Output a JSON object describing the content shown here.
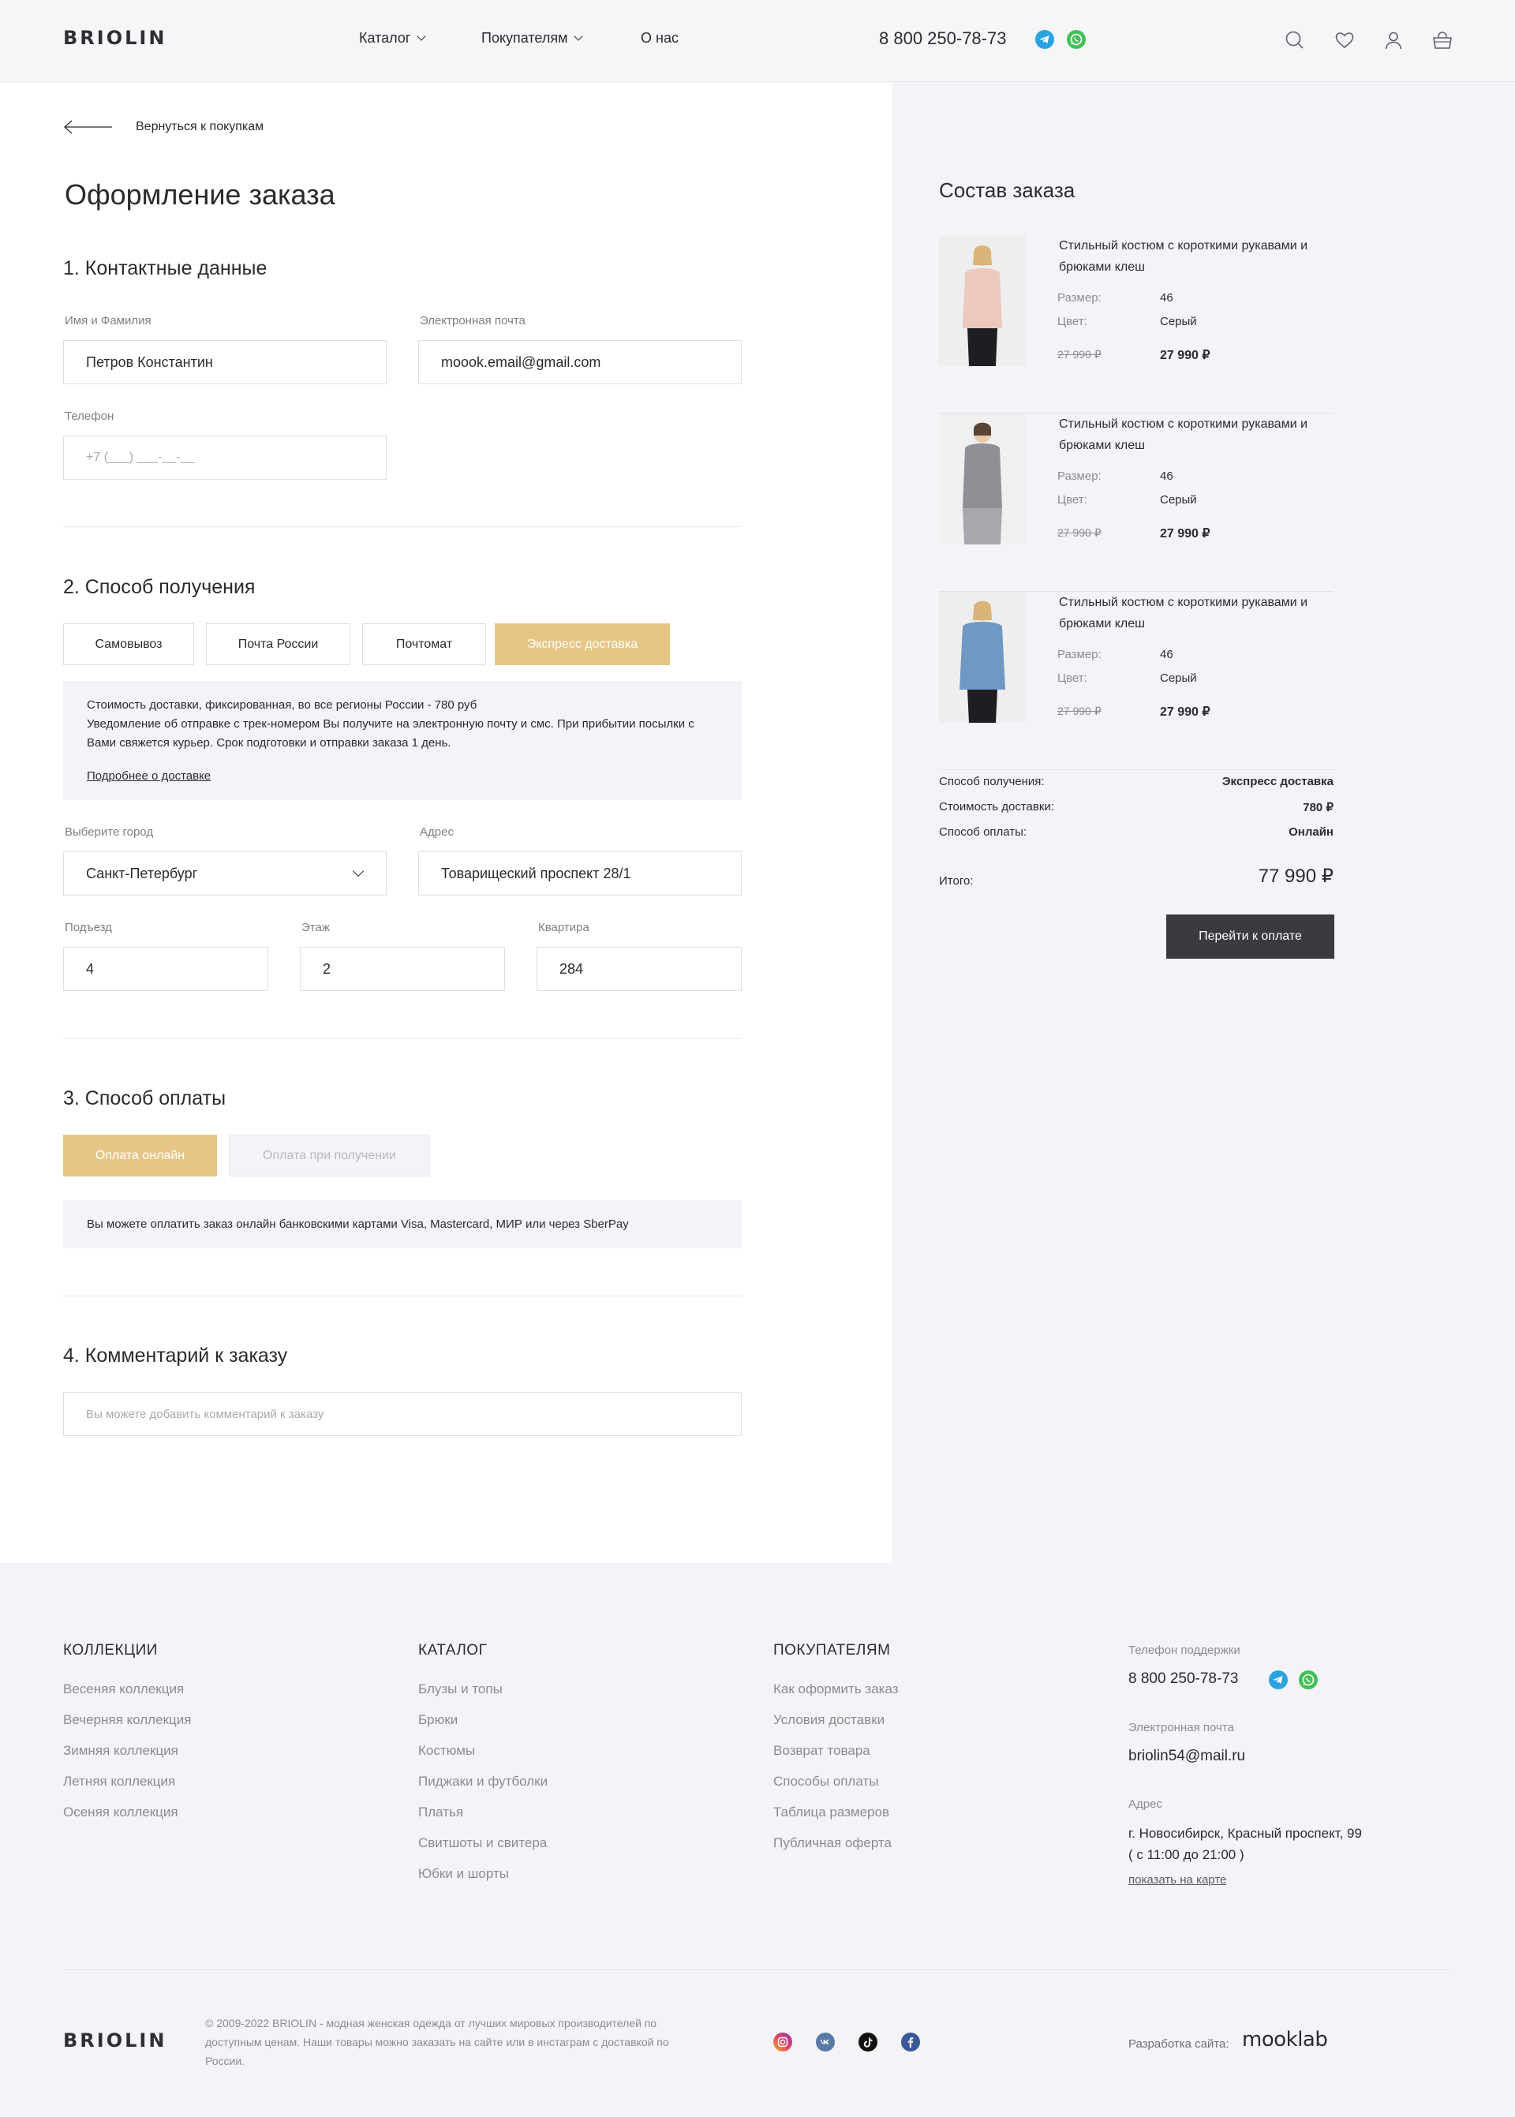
{
  "header": {
    "logo": "BRIOLIN",
    "nav": [
      {
        "label": "Каталог"
      },
      {
        "label": "Покупателям"
      },
      {
        "label": "О нас"
      }
    ],
    "phone": "8 800 250-78-73",
    "icons": [
      "search-icon",
      "heart-icon",
      "user-icon",
      "cart-icon"
    ]
  },
  "checkout": {
    "back_label": "Вернуться к покупкам",
    "title": "Оформление заказа",
    "contacts": {
      "title": "1. Контактные данные",
      "name_label": "Имя и Фамилия",
      "name_value": "Петров Константин",
      "email_label": "Электронная почта",
      "email_value": "moook.email@gmail.com",
      "phone_label": "Телефон",
      "phone_placeholder": "+7 (___) ___-__-__"
    },
    "delivery": {
      "title": "2. Способ получения",
      "options": [
        "Самовывоз",
        "Почта России",
        "Почтомат",
        "Экспресс доставка"
      ],
      "selected": "Экспресс доставка",
      "info_line1": "Стоимость доставки, фиксированная, во все регионы России - 780 руб",
      "info_line2": "Уведомление об отправке с трек-номером Вы получите на электронную почту и смс. При прибытии посылки с Вами свяжется курьер. Срок подготовки и отправки заказа 1 день.",
      "info_link": "Подробнее о доставке",
      "city_label": "Выберите город",
      "city_value": "Санкт-Петербург",
      "address_label": "Адрес",
      "address_value": "Товарищеский проспект 28/1",
      "entrance_label": "Подъезд",
      "entrance_value": "4",
      "floor_label": "Этаж",
      "floor_value": "2",
      "apartment_label": "Квартира",
      "apartment_value": "284"
    },
    "payment": {
      "title": "3. Способ оплаты",
      "options": [
        "Оплата онлайн",
        "Оплата при получении"
      ],
      "selected": "Оплата онлайн",
      "info": "Вы можете оплатить заказ онлайн банковскими картами Visa, Mastercard, МИР или через SberPay"
    },
    "comment": {
      "title": "4. Комментарий к заказу",
      "placeholder": "Вы можете добавить комментарий к заказу"
    }
  },
  "order": {
    "title": "Состав заказа",
    "items": [
      {
        "name": "Стильный костюм с короткими рукавами и брюками клеш",
        "size_label": "Размер:",
        "size": "46",
        "color_label": "Цвет:",
        "color": "Серый",
        "old_price": "27 990 ₽",
        "price": "27 990 ₽",
        "image_colors": {
          "top": "#ecc9bf",
          "bottom": "#1e1e22"
        }
      },
      {
        "name": "Стильный костюм с короткими рукавами и брюками клеш",
        "size_label": "Размер:",
        "size": "46",
        "color_label": "Цвет:",
        "color": "Серый",
        "old_price": "27 990 ₽",
        "price": "27 990 ₽",
        "image_colors": {
          "top": "#8e9096",
          "bottom": "#a6a8ae"
        }
      },
      {
        "name": "Стильный костюм с короткими рукавами и брюками клеш",
        "size_label": "Размер:",
        "size": "46",
        "color_label": "Цвет:",
        "color": "Серый",
        "old_price": "27 990 ₽",
        "price": "27 990 ₽",
        "image_colors": {
          "top": "#6f99c2",
          "bottom": "#1e1e22"
        }
      }
    ],
    "summary": [
      {
        "label": "Способ получения:",
        "value": "Экспресс доставка"
      },
      {
        "label": "Стоимость доставки:",
        "value": "780 ₽"
      },
      {
        "label": "Способ оплаты:",
        "value": "Онлайн"
      }
    ],
    "total_label": "Итого:",
    "total_value": "77 990 ₽",
    "pay_button": "Перейти к оплате"
  },
  "footer": {
    "collections": {
      "title": "КОЛЛЕКЦИИ",
      "links": [
        "Весеняя коллекция",
        "Вечерняя коллекция",
        "Зимняя коллекция",
        "Летняя коллекция",
        "Осеняя коллекция"
      ]
    },
    "catalog": {
      "title": "КАТАЛОГ",
      "links": [
        "Блузы и топы",
        "Брюки",
        "Костюмы",
        "Пиджаки и футболки",
        "Платья",
        "Свитшоты и свитера",
        "Юбки и шорты"
      ]
    },
    "buyers": {
      "title": "ПОКУПАТЕЛЯМ",
      "links": [
        "Как оформить заказ",
        "Условия доставки",
        "Возврат товара",
        "Способы оплаты",
        "Таблица размеров",
        "Публичная оферта"
      ]
    },
    "contacts": {
      "phone_label": "Телефон поддержки",
      "phone": "8 800 250-78-73",
      "email_label": "Электронная почта",
      "email": "briolin54@mail.ru",
      "address_label": "Адрес",
      "address": "г. Новосибирск, Красный проспект, 99 ( с 11:00 до 21:00 )",
      "map_link": "показать на карте"
    },
    "logo": "BRIOLIN",
    "copyright": "© 2009-2022 BRIOLIN - модная женская одежда от лучших мировых производителей по доступным ценам. Наши товары можно заказать на сайте или в инстаграм с доставкой по России.",
    "socials": [
      "instagram-icon",
      "vk-icon",
      "tiktok-icon",
      "facebook-icon"
    ],
    "dev_label": "Разработка сайта:",
    "dev_name": "mooklab"
  },
  "colors": {
    "accent": "#e6c687",
    "dark_button": "#3a3a3f",
    "panel_bg": "#f4f4f8",
    "telegram": "#2aa3df",
    "whatsapp": "#43c058"
  }
}
